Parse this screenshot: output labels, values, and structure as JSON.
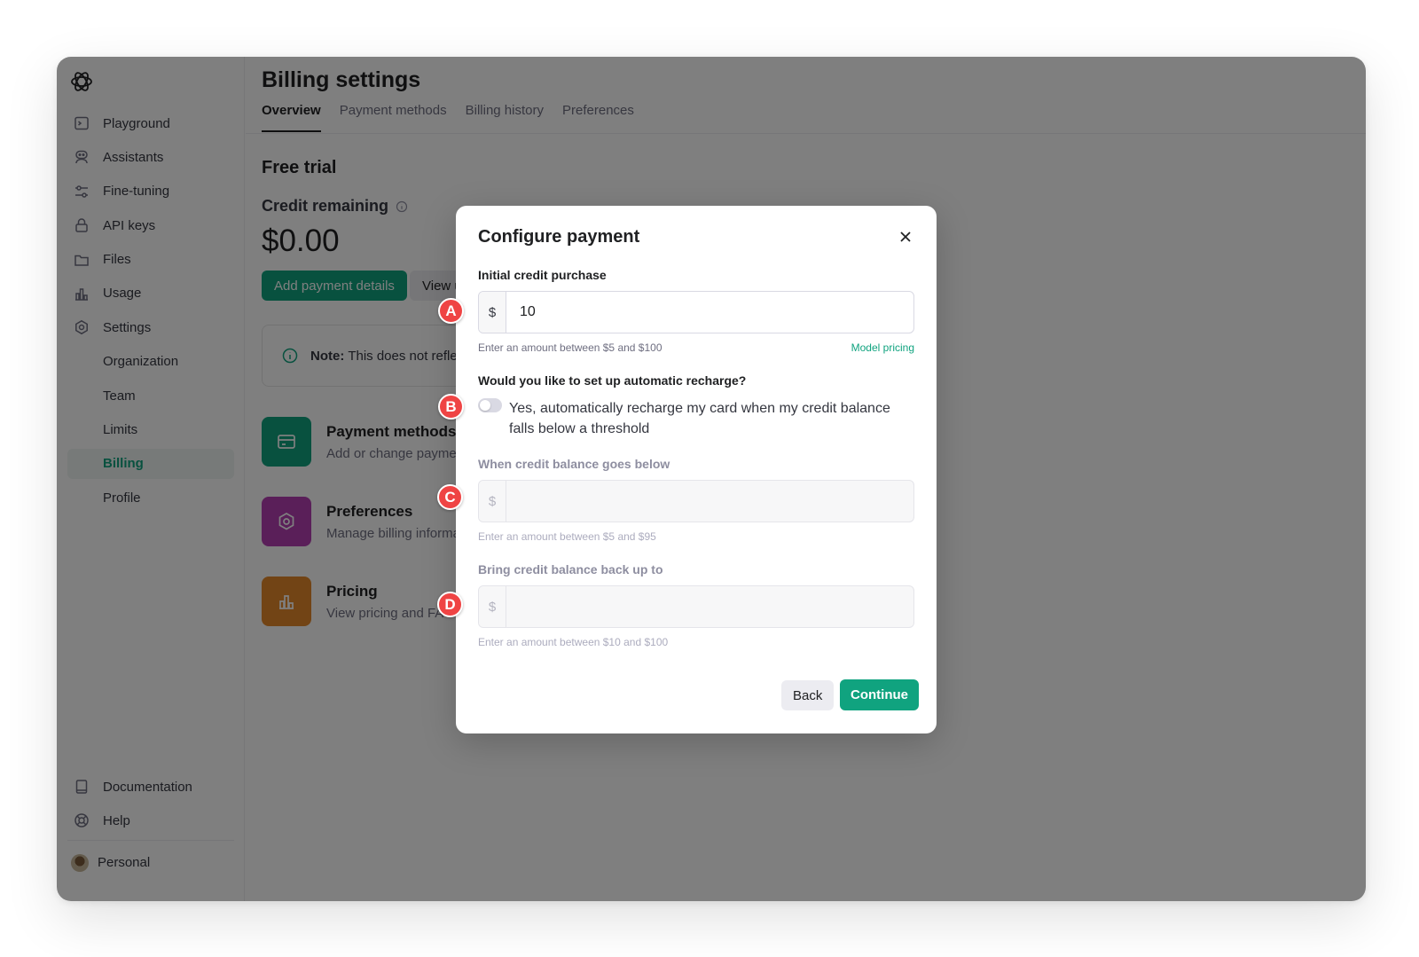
{
  "sidebar": {
    "items": [
      {
        "label": "Playground",
        "icon": "terminal-icon"
      },
      {
        "label": "Assistants",
        "icon": "assistant-icon"
      },
      {
        "label": "Fine-tuning",
        "icon": "sliders-icon"
      },
      {
        "label": "API keys",
        "icon": "lock-icon"
      },
      {
        "label": "Files",
        "icon": "folder-icon"
      },
      {
        "label": "Usage",
        "icon": "bar-chart-icon"
      },
      {
        "label": "Settings",
        "icon": "gear-icon"
      }
    ],
    "sub_items": [
      "Organization",
      "Team",
      "Limits",
      "Billing",
      "Profile"
    ],
    "active_item": "Billing",
    "bottom": {
      "documentation": "Documentation",
      "help": "Help",
      "personal": "Personal"
    }
  },
  "header": {
    "title": "Billing settings",
    "tabs": [
      "Overview",
      "Payment methods",
      "Billing history",
      "Preferences"
    ],
    "active_tab": "Overview"
  },
  "overview": {
    "plan": "Free trial",
    "credit_label": "Credit remaining",
    "credit_value": "$0.00",
    "add_payment_label": "Add payment details",
    "view_label": "View u",
    "note_bold": "Note:",
    "note_text": "This does not reflec",
    "cards": [
      {
        "title": "Payment methods",
        "desc": "Add or change paymen",
        "color": "#10a37f",
        "icon": "credit-card-icon"
      },
      {
        "title": "Preferences",
        "desc": "Manage billing informa",
        "color": "#b43fb3",
        "icon": "gear-icon"
      },
      {
        "title": "Pricing",
        "desc": "View pricing and FA",
        "color": "#e5892b",
        "icon": "bar-chart-icon"
      }
    ]
  },
  "modal": {
    "title": "Configure payment",
    "initial": {
      "label": "Initial credit purchase",
      "prefix": "$",
      "value": "10",
      "help": "Enter an amount between $5 and $100",
      "link": "Model pricing"
    },
    "recharge_question": "Would you like to set up automatic recharge?",
    "toggle_text": "Yes, automatically recharge my card when my credit balance falls below a threshold",
    "toggle_on": false,
    "threshold": {
      "label": "When credit balance goes below",
      "prefix": "$",
      "value": "",
      "help": "Enter an amount between $5 and $95"
    },
    "recharge_to": {
      "label": "Bring credit balance back up to",
      "prefix": "$",
      "value": "",
      "help": "Enter an amount between $10 and $100"
    },
    "back_label": "Back",
    "continue_label": "Continue"
  },
  "markers": [
    "A",
    "B",
    "C",
    "D"
  ],
  "colors": {
    "accent": "#10a37f",
    "marker": "#ef4444"
  }
}
